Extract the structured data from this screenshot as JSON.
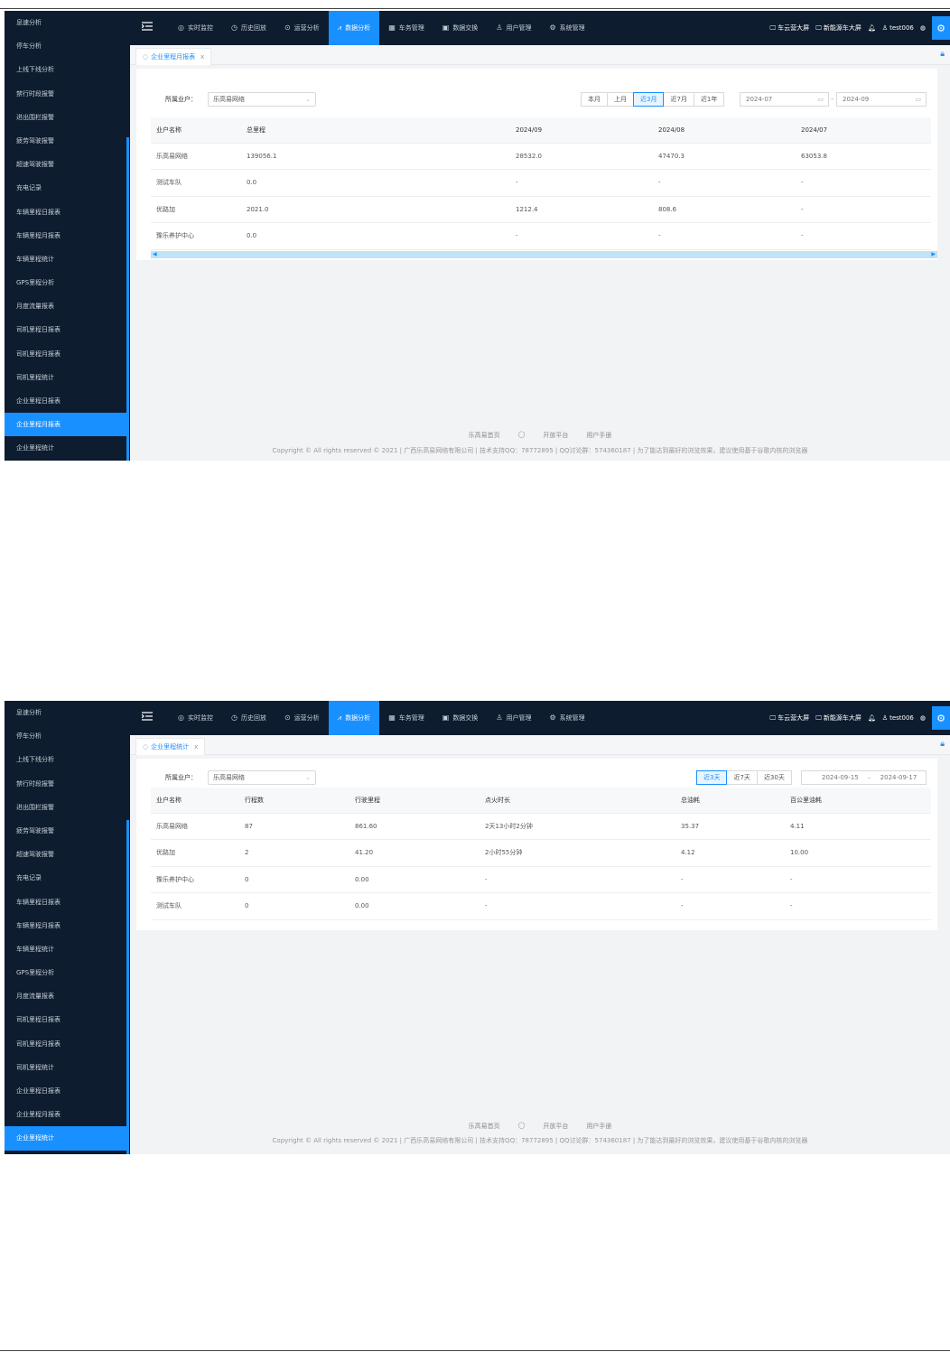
{
  "nav": {
    "items": [
      {
        "icon": "◎",
        "label": "实时监控"
      },
      {
        "icon": "◷",
        "label": "历史回放"
      },
      {
        "icon": "⊙",
        "label": "运营分析"
      },
      {
        "icon": "⩘",
        "label": "数据分析"
      },
      {
        "icon": "▦",
        "label": "车务管理"
      },
      {
        "icon": "▣",
        "label": "数据交换"
      },
      {
        "icon": "♙",
        "label": "用户管理"
      },
      {
        "icon": "⚙",
        "label": "系统管理"
      }
    ],
    "active_index": 3,
    "right": {
      "screen1": "车云营大屏",
      "screen2": "新能源车大屏",
      "user": "test006"
    }
  },
  "footer": {
    "links": [
      "乐高易首页",
      "开放平台",
      "用户手册"
    ],
    "copyright": "Copyright © All rights reserved © 2021 | 广西乐高易网络有限公司 | 技术支持QQ：78772895 | QQ讨论群：574360187 | 为了能达到最好的浏览效果，建议使用基于谷歌内核的浏览器"
  },
  "shot1": {
    "sidebar": [
      "息速分析",
      "停车分析",
      "上线下线分析",
      "禁行时段报警",
      "进出围栏报警",
      "疲劳驾驶报警",
      "超速驾驶报警",
      "充电记录",
      "车辆里程日报表",
      "车辆里程月报表",
      "车辆里程统计",
      "GPS里程分析",
      "月度流量报表",
      "司机里程日报表",
      "司机里程月报表",
      "司机里程统计",
      "企业里程日报表",
      "企业里程月报表",
      "企业里程统计"
    ],
    "sidebar_active": 17,
    "tab": "企业里程月报表",
    "filter_label": "所属业户：",
    "select_value": "乐高易网络",
    "range_buttons": [
      "本月",
      "上月",
      "近3月",
      "近7月",
      "近1年"
    ],
    "range_active": 2,
    "date_start": "2024-07",
    "date_end": "2024-09",
    "columns": [
      "业户名称",
      "总里程",
      "2024/09",
      "2024/08",
      "2024/07"
    ],
    "rows": [
      [
        "乐高易网络",
        "139056.1",
        "28532.0",
        "47470.3",
        "63053.8"
      ],
      [
        "测试车队",
        "0.0",
        "-",
        "-",
        "-"
      ],
      [
        "优路加",
        "2021.0",
        "1212.4",
        "808.6",
        "-"
      ],
      [
        "豫乐养护中心",
        "0.0",
        "-",
        "-",
        "-"
      ]
    ]
  },
  "shot2": {
    "sidebar": [
      "息速分析",
      "停车分析",
      "上线下线分析",
      "禁行时段报警",
      "进出围栏报警",
      "疲劳驾驶报警",
      "超速驾驶报警",
      "充电记录",
      "车辆里程日报表",
      "车辆里程月报表",
      "车辆里程统计",
      "GPS里程分析",
      "月度流量报表",
      "司机里程日报表",
      "司机里程月报表",
      "司机里程统计",
      "企业里程日报表",
      "企业里程月报表",
      "企业里程统计"
    ],
    "sidebar_active": 18,
    "tab": "企业里程统计",
    "filter_label": "所属业户：",
    "select_value": "乐高易网络",
    "range_buttons": [
      "近3天",
      "近7天",
      "近30天"
    ],
    "range_active": 0,
    "date_start": "2024-09-15",
    "date_end": "2024-09-17",
    "columns": [
      "业户名称",
      "行程数",
      "行驶里程",
      "点火时长",
      "总油耗",
      "百公里油耗"
    ],
    "rows": [
      [
        "乐高易网络",
        "87",
        "861.60",
        "2天13小时2分钟",
        "35.37",
        "4.11"
      ],
      [
        "优路加",
        "2",
        "41.20",
        "2小时55分钟",
        "4.12",
        "10.00"
      ],
      [
        "豫乐养护中心",
        "0",
        "0.00",
        "-",
        "-",
        "-"
      ],
      [
        "测试车队",
        "0",
        "0.00",
        "-",
        "-",
        "-"
      ]
    ]
  }
}
